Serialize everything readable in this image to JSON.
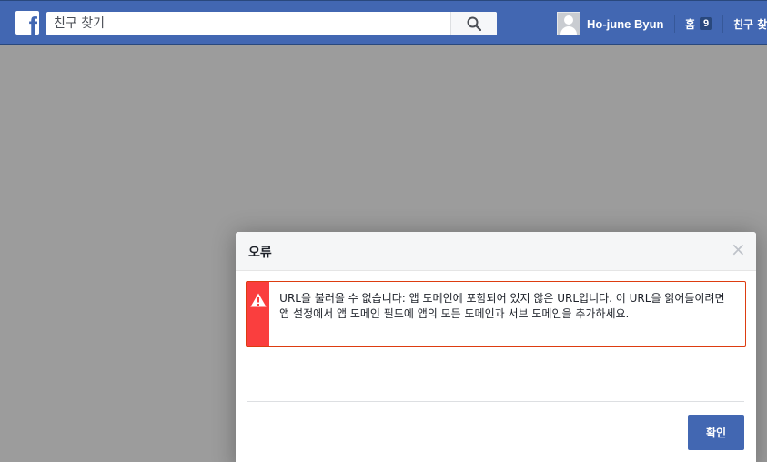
{
  "topbar": {
    "logo_letter": "f",
    "search": {
      "placeholder": "친구 찾기",
      "icon": "search-icon"
    },
    "user": {
      "name": "Ho-june Byun",
      "avatar_icon": "default-avatar-icon"
    },
    "home": {
      "label": "홈",
      "count": "9"
    },
    "find_friends": "친구 찾기"
  },
  "dialog": {
    "title": "오류",
    "close_icon": "close-icon",
    "error": {
      "icon": "warning-icon",
      "message": "URL을 불러올 수 없습니다: 앱 도메인에 포함되어 있지 않은 URL입니다. 이 URL을 읽어들이려면 앱 설정에서 앱 도메인 필드에 앱의 모든 도메인과 서브 도메인을 추가하세요."
    },
    "confirm_label": "확인"
  },
  "colors": {
    "brand_blue": "#4267b2",
    "error_red": "#fa3e3e",
    "overlay": "#9c9c9c"
  }
}
